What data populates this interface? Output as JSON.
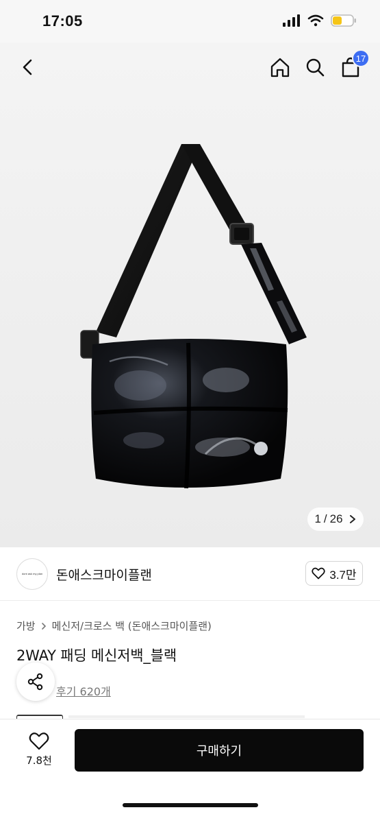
{
  "status_bar": {
    "time": "17:05",
    "battery": "low"
  },
  "nav": {
    "cart_count": "17"
  },
  "gallery": {
    "current": "1",
    "separator": "/",
    "total": "26"
  },
  "brand": {
    "logo_text": "dont ask my plan",
    "name": "돈애스크마이플랜",
    "likes": "3.7만"
  },
  "breadcrumb": {
    "category": "가방",
    "subcategory": "메신저/크로스 백 (돈애스크마이플랜)"
  },
  "product": {
    "title": "2WAY 패딩 메신저백_블랙",
    "reviews": "후기 620개"
  },
  "bottom": {
    "wish_count": "7.8천",
    "buy_label": "구매하기"
  },
  "colors": {
    "accent": "#3d6df2",
    "buy_button": "#0a0a0a",
    "battery": "#f5c518"
  }
}
